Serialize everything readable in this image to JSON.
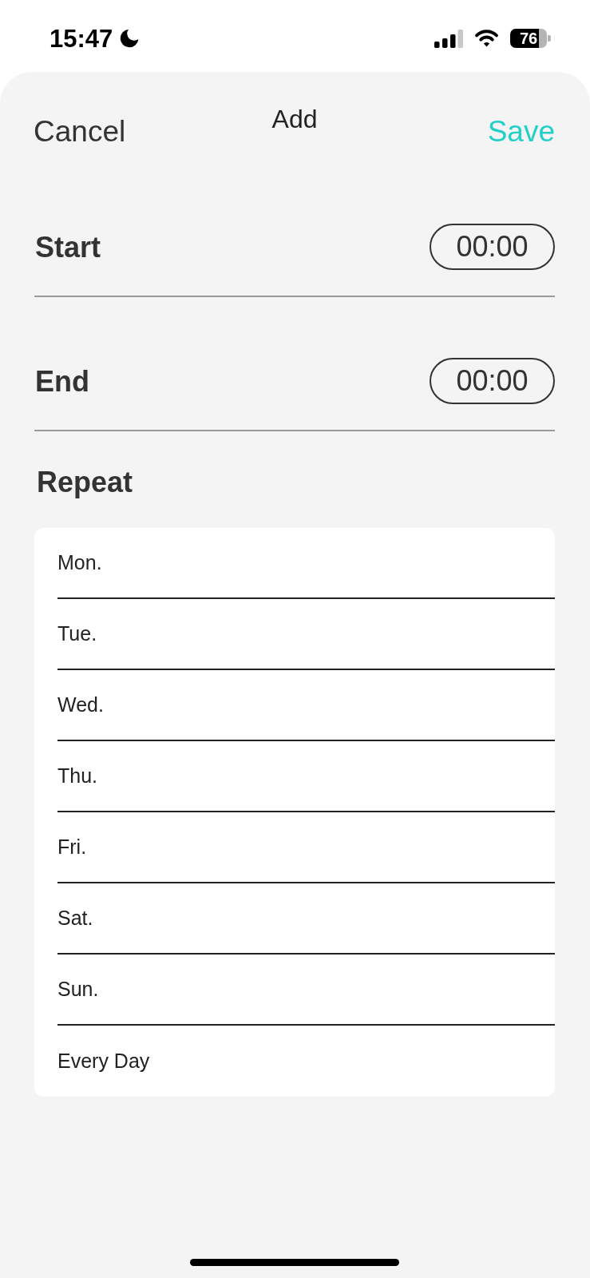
{
  "status_bar": {
    "time": "15:47",
    "battery": "76"
  },
  "header": {
    "cancel": "Cancel",
    "title": "Add",
    "save": "Save"
  },
  "time_rows": [
    {
      "label": "Start",
      "value": "00:00"
    },
    {
      "label": "End",
      "value": "00:00"
    }
  ],
  "repeat": {
    "title": "Repeat",
    "days": [
      {
        "label": "Mon."
      },
      {
        "label": "Tue."
      },
      {
        "label": "Wed."
      },
      {
        "label": "Thu."
      },
      {
        "label": "Fri."
      },
      {
        "label": "Sat."
      },
      {
        "label": "Sun."
      },
      {
        "label": "Every Day"
      }
    ]
  }
}
